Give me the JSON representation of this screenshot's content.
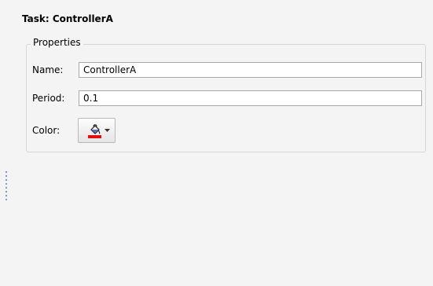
{
  "task": {
    "title": "Task: ControllerA"
  },
  "properties": {
    "group_label": "Properties",
    "name": {
      "label": "Name:",
      "value": "ControllerA"
    },
    "period": {
      "label": "Period:",
      "value": "0.1"
    },
    "color": {
      "label": "Color:",
      "button_icon": "paint-bucket-icon",
      "swatch_color": "#e01010",
      "arrow_icon": "chevron-down-icon"
    }
  }
}
